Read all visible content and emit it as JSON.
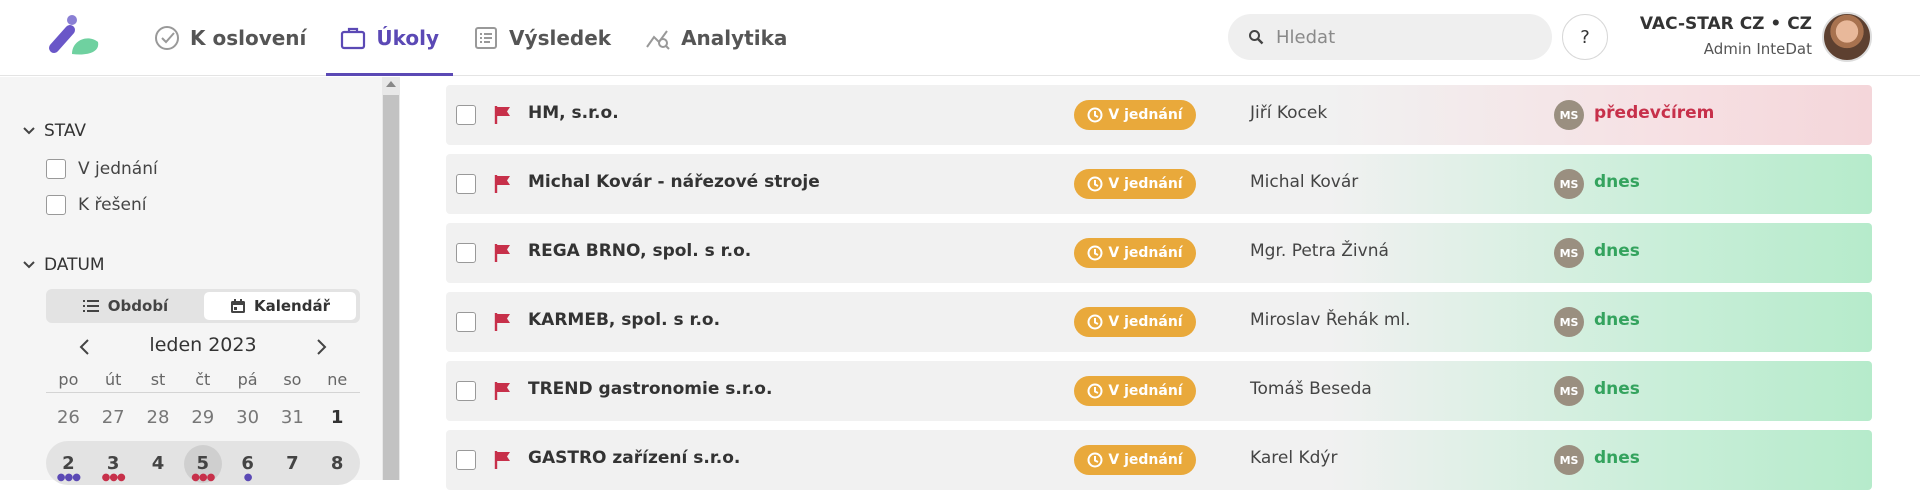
{
  "nav": {
    "items": [
      {
        "label": "K oslovení",
        "icon": "check-circle-icon",
        "active": false
      },
      {
        "label": "Úkoly",
        "icon": "briefcase-icon",
        "active": true
      },
      {
        "label": "Výsledek",
        "icon": "list-icon",
        "active": false
      },
      {
        "label": "Analytika",
        "icon": "analytics-icon",
        "active": false
      }
    ]
  },
  "search": {
    "placeholder": "Hledat"
  },
  "help": {
    "label": "?"
  },
  "user": {
    "company": "VAC-STAR CZ • CZ",
    "role": "Admin InteDat"
  },
  "colors": {
    "accent": "#5b49b5",
    "status": "#e9a93b",
    "green": "#34a35e",
    "red": "#c7304a"
  },
  "filters": {
    "stav": {
      "title": "STAV",
      "options": [
        "V jednání",
        "K řešení"
      ]
    },
    "datum": {
      "title": "DATUM",
      "toggle": {
        "period": "Období",
        "calendar": "Kalendář",
        "selected": "Kalendář"
      },
      "calendar": {
        "month": "leden 2023",
        "weekdays": [
          "po",
          "út",
          "st",
          "čt",
          "pá",
          "so",
          "ne"
        ],
        "week1": [
          "26",
          "27",
          "28",
          "29",
          "30",
          "31",
          "1"
        ],
        "week2": [
          "2",
          "3",
          "4",
          "5",
          "6",
          "7",
          "8"
        ],
        "selected_day": "5"
      }
    }
  },
  "tasks": [
    {
      "name": "HM, s.r.o.",
      "status": "V jednání",
      "contact": "Jiří Kocek",
      "owner": "MS",
      "when": "předevčírem",
      "tone": "red"
    },
    {
      "name": "Michal Kovár - nářezové stroje",
      "status": "V jednání",
      "contact": "Michal Kovár",
      "owner": "MS",
      "when": "dnes",
      "tone": "green"
    },
    {
      "name": "REGA BRNO, spol. s r.o.",
      "status": "V jednání",
      "contact": "Mgr. Petra Živná",
      "owner": "MS",
      "when": "dnes",
      "tone": "green"
    },
    {
      "name": "KARMEB, spol. s r.o.",
      "status": "V jednání",
      "contact": "Miroslav Řehák ml.",
      "owner": "MS",
      "when": "dnes",
      "tone": "green"
    },
    {
      "name": "TREND gastronomie s.r.o.",
      "status": "V jednání",
      "contact": "Tomáš Beseda",
      "owner": "MS",
      "when": "dnes",
      "tone": "green"
    },
    {
      "name": "GASTRO zařízení s.r.o.",
      "status": "V jednání",
      "contact": "Karel Kdýr",
      "owner": "MS",
      "when": "dnes",
      "tone": "green"
    }
  ]
}
